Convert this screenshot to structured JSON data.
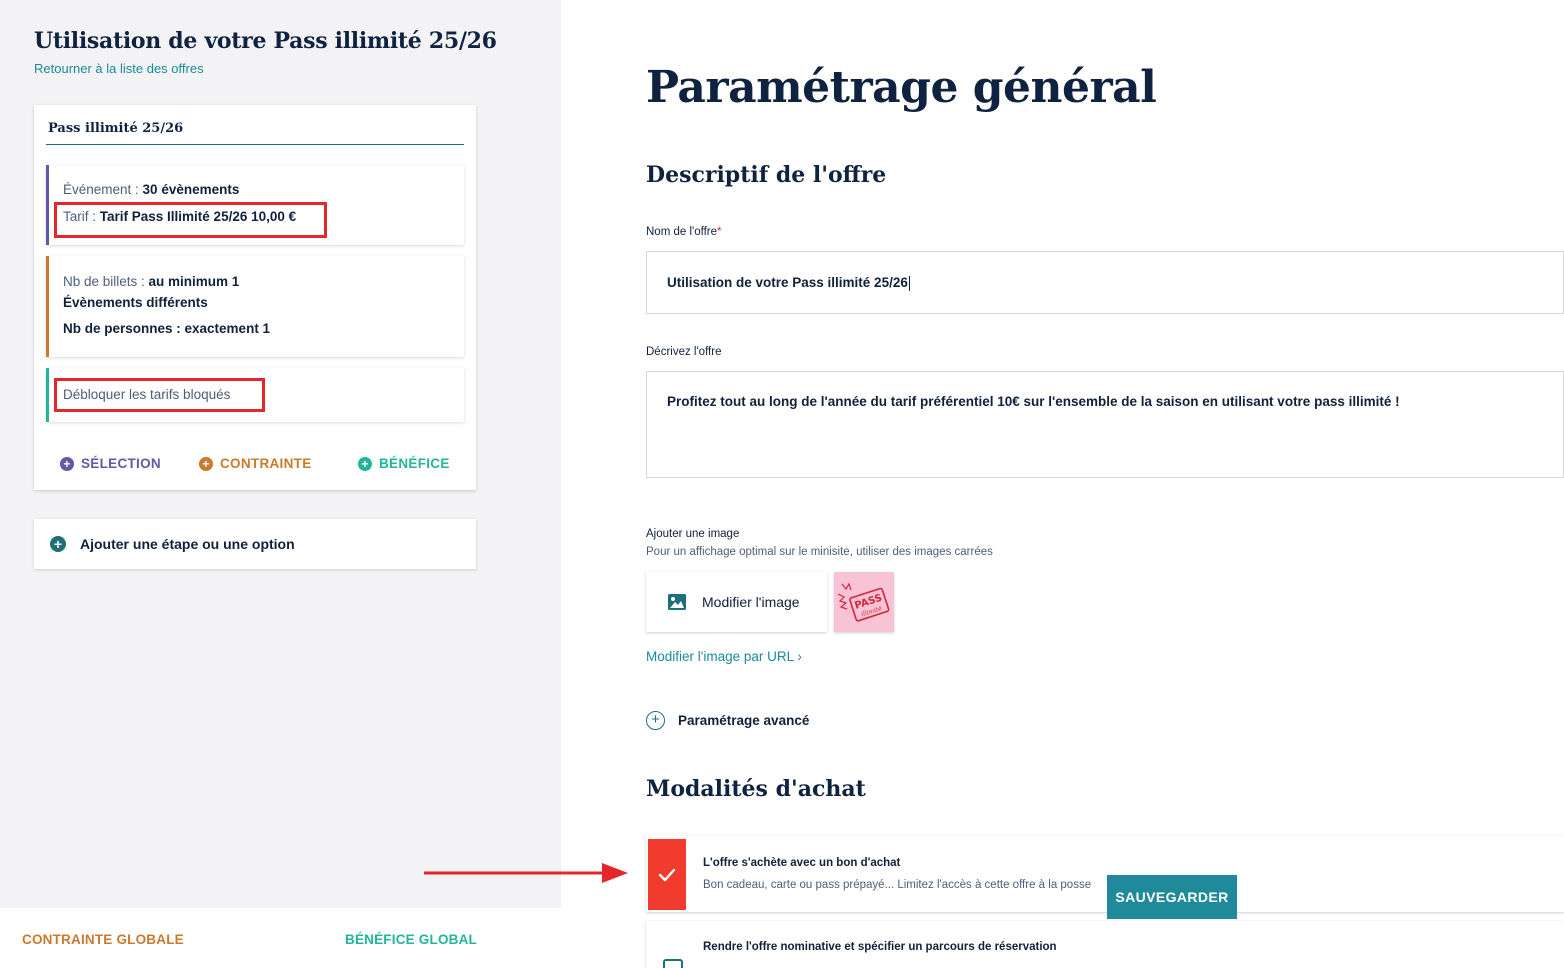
{
  "left": {
    "title": "Utilisation de votre Pass illimité 25/26",
    "back_link": "Retourner à la liste des offres",
    "card": {
      "title": "Pass illimité 25/26",
      "selection": {
        "event_label": "Événement : ",
        "event_value": "30 évènements",
        "tarif_label": "Tarif : ",
        "tarif_value": "Tarif Pass Illimité 25/26 10,00 €"
      },
      "contrainte": {
        "tickets_label": "Nb de billets : ",
        "tickets_value": "au minimum 1",
        "events_distinct": "Évènements différents",
        "persons": "Nb de personnes : exactement 1"
      },
      "benefice": {
        "label": "Débloquer les tarifs bloqués"
      },
      "buttons": {
        "selection": "SÉLECTION",
        "contrainte": "CONTRAINTE",
        "benefice": "BÉNÉFICE"
      }
    },
    "add_step": "Ajouter une étape ou une option",
    "global": {
      "contrainte": "CONTRAINTE GLOBALE",
      "benefice": "BÉNÉFICE GLOBAL"
    }
  },
  "main": {
    "title": "Paramétrage général",
    "descriptif": {
      "heading": "Descriptif de l'offre",
      "name_label": "Nom de l'offre",
      "name_required": "*",
      "name_value": "Utilisation de votre Pass illimité 25/26",
      "desc_label": "Décrivez l'offre",
      "desc_value": "Profitez tout au long de l'année du tarif préférentiel 10€ sur l'ensemble de la saison en utilisant votre pass illimité !",
      "image_label": "Ajouter une image",
      "image_hint": "Pour un affichage optimal sur le minisite, utiliser des images carrées",
      "modify_image": "Modifier l'image",
      "modify_url": "Modifier l'image par URL ›",
      "advanced": "Paramétrage avancé"
    },
    "modalites": {
      "heading": "Modalités d'achat",
      "voucher_title": "L'offre s'achète avec un bon d'achat",
      "voucher_desc": "Bon cadeau, carte ou pass prépayé... Limitez l'accès à cette offre à la posse",
      "nominative_title": "Rendre l'offre nominative et spécifier un parcours de réservation",
      "nominative_desc": ""
    },
    "save_button": "SAUVEGARDER"
  },
  "colors": {
    "selection": "#5e5aa8",
    "contrainte": "#c97a2d",
    "benefice": "#23b59a",
    "accent": "#1e8a9a",
    "highlight": "#e3272b"
  }
}
